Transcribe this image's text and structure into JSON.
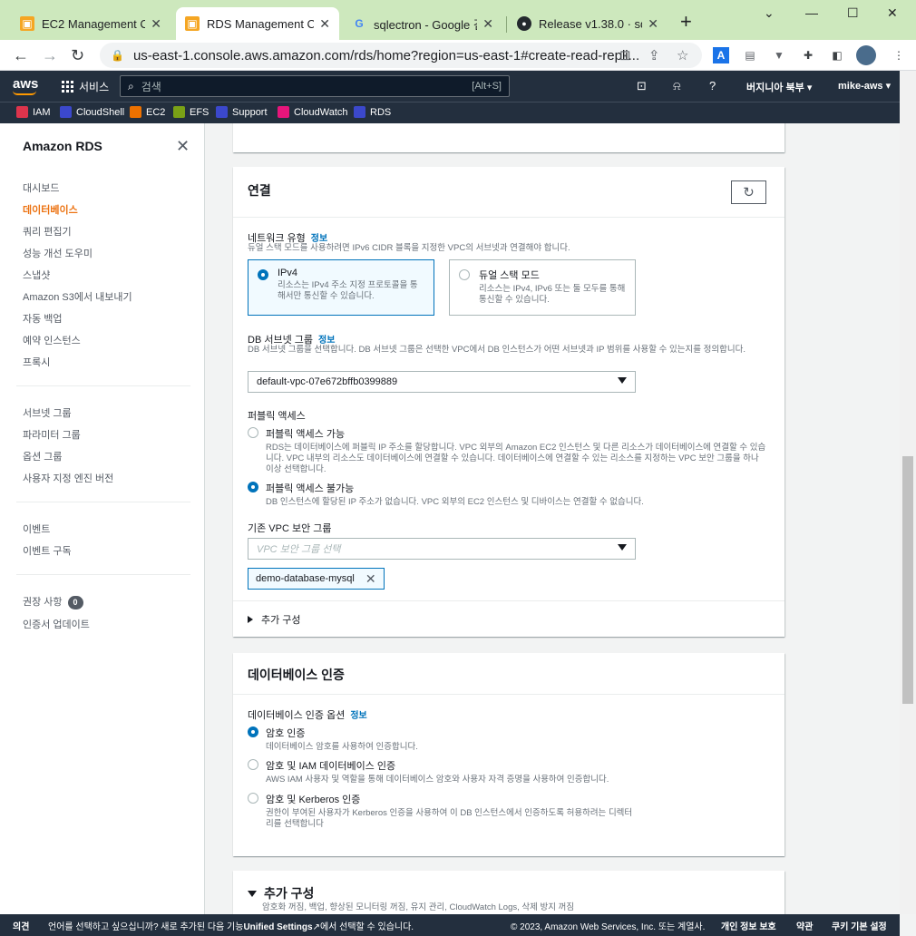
{
  "browser": {
    "tabs": [
      {
        "title": "EC2 Management Co",
        "active": false
      },
      {
        "title": "RDS Management Co",
        "active": true
      },
      {
        "title": "sqlectron - Google 검",
        "active": false
      },
      {
        "title": "Release v1.38.0 · sqle",
        "active": false
      }
    ],
    "url": "us-east-1.console.aws.amazon.com/rds/home?region=us-east-1#create-read-repli..."
  },
  "aws_header": {
    "logo": "aws",
    "services": "서비스",
    "search_placeholder": "검색",
    "search_shortcut": "[Alt+S]",
    "region": "버지니아 북부 ▾",
    "account": "mike-aws ▾"
  },
  "favorites": [
    "IAM",
    "CloudShell",
    "EC2",
    "EFS",
    "Support",
    "CloudWatch",
    "RDS"
  ],
  "sidebar": {
    "title": "Amazon RDS",
    "group1": [
      "대시보드",
      "데이터베이스",
      "쿼리 편집기",
      "성능 개선 도우미",
      "스냅샷",
      "Amazon S3에서 내보내기",
      "자동 백업",
      "예약 인스턴스",
      "프록시"
    ],
    "group2": [
      "서브넷 그룹",
      "파라미터 그룹",
      "옵션 그룹",
      "사용자 지정 엔진 버전"
    ],
    "group3": [
      "이벤트",
      "이벤트 구독"
    ],
    "group4": {
      "recommendations": "권장 사항",
      "recommendations_count": "0",
      "cert_update": "인증서 업데이트"
    }
  },
  "connectivity": {
    "title": "연결",
    "network_type_label": "네트워크 유형",
    "info": "정보",
    "network_type_desc": "듀얼 스택 모드를 사용하려면 IPv6 CIDR 블록을 지정한 VPC의 서브넷과 연결해야 합니다.",
    "ipv4_title": "IPv4",
    "ipv4_desc": "리소스는 IPv4 주소 지정 프로토콜을 통해서만 통신할 수 있습니다.",
    "dual_title": "듀얼 스택 모드",
    "dual_desc": "리소스는 IPv4, IPv6 또는 둘 모두를 통해 통신할 수 있습니다.",
    "subnet_label": "DB 서브넷 그룹",
    "subnet_desc": "DB 서브넷 그룹을 선택합니다. DB 서브넷 그룹은 선택한 VPC에서 DB 인스턴스가 어떤 서브넷과 IP 범위를 사용할 수 있는지를 정의합니다.",
    "subnet_value": "default-vpc-07e672bffb0399889",
    "public_label": "퍼블릭 액세스",
    "public_yes_title": "퍼블릭 액세스 가능",
    "public_yes_desc": "RDS는 데이터베이스에 퍼블릭 IP 주소를 할당합니다. VPC 외부의 Amazon EC2 인스턴스 및 다른 리소스가 데이터베이스에 연결할 수 있습니다. VPC 내부의 리소스도 데이터베이스에 연결할 수 있습니다. 데이터베이스에 연결할 수 있는 리소스를 지정하는 VPC 보안 그룹을 하나 이상 선택합니다.",
    "public_no_title": "퍼블릭 액세스 불가능",
    "public_no_desc": "DB 인스턴스에 할당된 IP 주소가 없습니다. VPC 외부의 EC2 인스턴스 및 디바이스는 연결할 수 없습니다.",
    "sg_label": "기존 VPC 보안 그룹",
    "sg_placeholder": "VPC 보안 그룹 선택",
    "sg_token": "demo-database-mysql",
    "additional": "추가 구성"
  },
  "auth": {
    "title": "데이터베이스 인증",
    "options_label": "데이터베이스 인증 옵션",
    "info": "정보",
    "opt1_title": "암호 인증",
    "opt1_desc": "데이터베이스 암호를 사용하여 인증합니다.",
    "opt2_title": "암호 및 IAM 데이터베이스 인증",
    "opt2_desc": "AWS IAM 사용자 및 역할을 통해 데이터베이스 암호와 사용자 자격 증명을 사용하여 인증합니다.",
    "opt3_title": "암호 및 Kerberos 인증",
    "opt3_desc": "권한이 부여된 사용자가 Kerberos 인증을 사용하여 이 DB 인스턴스에서 인증하도록 허용하려는 디렉터리를 선택합니다"
  },
  "extra": {
    "title": "추가 구성",
    "desc": "암호화 꺼짐, 백업, 향상된 모니터링 꺼짐, 유지 관리, CloudWatch Logs, 삭제 방지 꺼짐"
  },
  "footer": {
    "feedback": "의견",
    "language_prefix": "언어를 선택하고 싶으십니까? 새로 추가된 다음 기능",
    "unified": "Unified Settings",
    "language_suffix": "에서 선택할 수 있습니다.",
    "copyright": "© 2023, Amazon Web Services, Inc. 또는 계열사.",
    "privacy": "개인 정보 보호",
    "terms": "약관",
    "cookies": "쿠키 기본 설정"
  },
  "colors": {
    "accent": "#ec7211",
    "link": "#0073bb",
    "header": "#232f3e",
    "tabbar": "#cde8bd"
  }
}
